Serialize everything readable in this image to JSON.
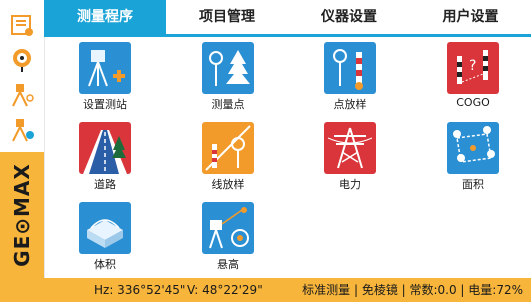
{
  "tabs": [
    {
      "label": "测量程序",
      "active": true
    },
    {
      "label": "项目管理",
      "active": false
    },
    {
      "label": "仪器设置",
      "active": false
    },
    {
      "label": "用户设置",
      "active": false
    }
  ],
  "sidebar": {
    "icons": [
      "job-icon",
      "target-orange-icon",
      "station-setup-icon",
      "station-info-icon"
    ],
    "brand": "GE⊙MAX"
  },
  "apps": [
    {
      "label": "设置测站",
      "icon": "station-setup-icon",
      "color": "#2a8fd3"
    },
    {
      "label": "测量点",
      "icon": "survey-point-icon",
      "color": "#2a8fd3"
    },
    {
      "label": "点放样",
      "icon": "point-stakeout-icon",
      "color": "#2a8fd3"
    },
    {
      "label": "COGO",
      "icon": "cogo-icon",
      "color": "#d9353a"
    },
    {
      "label": "道路",
      "icon": "road-icon",
      "color": "#d9353a"
    },
    {
      "label": "线放样",
      "icon": "line-stakeout-icon",
      "color": "#f39b2a"
    },
    {
      "label": "电力",
      "icon": "power-tower-icon",
      "color": "#d9353a"
    },
    {
      "label": "面积",
      "icon": "area-icon",
      "color": "#2a8fd3"
    },
    {
      "label": "体积",
      "icon": "volume-icon",
      "color": "#2a8fd3"
    },
    {
      "label": "悬高",
      "icon": "height-icon",
      "color": "#2a8fd3"
    }
  ],
  "status": {
    "hz": "Hz: 336°52'45\"",
    "v": "V: 48°22'29\"",
    "mode": "标准测量 | 免棱镜 | 常数:0.0 | 电量:72%"
  },
  "colors": {
    "accent": "#1aa3d6",
    "status_bar": "#f7b53b"
  }
}
